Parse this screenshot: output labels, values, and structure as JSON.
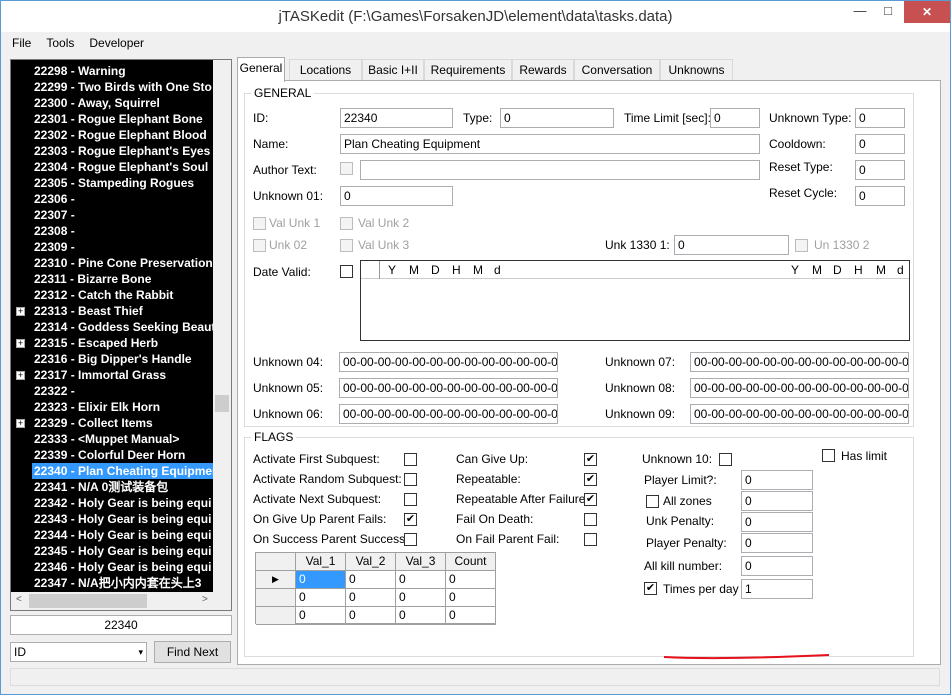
{
  "window": {
    "title": "jTASKedit (F:\\Games\\ForsakenJD\\element\\data\\tasks.data)",
    "close_glyph": "✕",
    "min_glyph": "—",
    "max_glyph": "□"
  },
  "menu": [
    "File",
    "Tools",
    "Developer"
  ],
  "tree": {
    "items": [
      {
        "label": "22298 - Warning",
        "exp": false
      },
      {
        "label": "22299 - Two Birds with One Sto",
        "exp": false
      },
      {
        "label": "22300 - Away, Squirrel",
        "exp": false
      },
      {
        "label": "22301 - Rogue Elephant Bone",
        "exp": false
      },
      {
        "label": "22302 - Rogue Elephant Blood",
        "exp": false
      },
      {
        "label": "22303 - Rogue Elephant's Eyes",
        "exp": false
      },
      {
        "label": "22304 - Rogue Elephant's Soul",
        "exp": false
      },
      {
        "label": "22305 - Stampeding Rogues",
        "exp": false
      },
      {
        "label": "22306 -",
        "exp": false
      },
      {
        "label": "22307 -",
        "exp": false
      },
      {
        "label": "22308 -",
        "exp": false
      },
      {
        "label": "22309 -",
        "exp": false
      },
      {
        "label": "22310 - Pine Cone Preservation",
        "exp": false
      },
      {
        "label": "22311 - Bizarre Bone",
        "exp": false
      },
      {
        "label": "22312 - Catch the Rabbit",
        "exp": false
      },
      {
        "label": "22313 - Beast Thief",
        "exp": true
      },
      {
        "label": "22314 - Goddess Seeking Beaut",
        "exp": false
      },
      {
        "label": "22315 - Escaped Herb",
        "exp": true
      },
      {
        "label": "22316 - Big Dipper's Handle",
        "exp": false
      },
      {
        "label": "22317 - Immortal Grass",
        "exp": true
      },
      {
        "label": "22322 -",
        "exp": false
      },
      {
        "label": "22323 - Elixir Elk Horn",
        "exp": false
      },
      {
        "label": "22329 - Collect Items",
        "exp": true
      },
      {
        "label": "22333 - <Muppet Manual>",
        "exp": false
      },
      {
        "label": "22339 - Colorful Deer Horn",
        "exp": false
      },
      {
        "label": "22340 - Plan Cheating Equipmen",
        "exp": false,
        "selected": true
      },
      {
        "label": "22341 - N/A 0测试装备包",
        "exp": false
      },
      {
        "label": "22342 - Holy Gear is being equi",
        "exp": false
      },
      {
        "label": "22343 - Holy Gear is being equi",
        "exp": false
      },
      {
        "label": "22344 - Holy Gear is being equi",
        "exp": false
      },
      {
        "label": "22345 - Holy Gear is being equi",
        "exp": false
      },
      {
        "label": "22346 - Holy Gear is being equi",
        "exp": false
      },
      {
        "label": "22347 - N/A把小内内套在头上3",
        "exp": false
      }
    ],
    "expand_glyph": "+",
    "scroll_left": "<",
    "scroll_right": ">"
  },
  "search": {
    "value": "22340",
    "field_select": "ID",
    "arrow": "▾",
    "find_next": "Find Next"
  },
  "tabs": [
    "General",
    "Locations",
    "Basic I+II",
    "Requirements",
    "Rewards",
    "Conversation",
    "Unknowns"
  ],
  "general": {
    "title": "GENERAL",
    "id_label": "ID:",
    "id": "22340",
    "type_label": "Type:",
    "type": "0",
    "time_limit_label": "Time Limit [sec]:",
    "time_limit": "0",
    "unknown_type_label": "Unknown Type:",
    "unknown_type": "0",
    "name_label": "Name:",
    "name": "Plan Cheating Equipment",
    "cooldown_label": "Cooldown:",
    "cooldown": "0",
    "author_label": "Author Text:",
    "author": "",
    "reset_type_label": "Reset Type:",
    "reset_type": "0",
    "unknown01_label": "Unknown 01:",
    "unknown01": "0",
    "reset_cycle_label": "Reset Cycle:",
    "reset_cycle": "0",
    "val_unk1": "Val Unk 1",
    "val_unk2": "Val Unk 2",
    "unk02": "Unk 02",
    "val_unk3": "Val Unk 3",
    "unk1330_1_label": "Unk 1330 1:",
    "unk1330_1": "0",
    "unk1330_2": "Un 1330 2",
    "date_valid_label": "Date Valid:",
    "date_cols": [
      "Y",
      "M",
      "D",
      "H",
      "M",
      "d"
    ],
    "unknown04_label": "Unknown 04:",
    "unknown04": "00-00-00-00-00-00-00-00-00-00-00-00-00-00-0",
    "unknown05_label": "Unknown 05:",
    "unknown05": "00-00-00-00-00-00-00-00-00-00-00-00-00-00-0",
    "unknown06_label": "Unknown 06:",
    "unknown06": "00-00-00-00-00-00-00-00-00-00-00-00-00",
    "unknown07_label": "Unknown 07:",
    "unknown07": "00-00-00-00-00-00-00-00-00-00-00-00-00-00-0",
    "unknown08_label": "Unknown 08:",
    "unknown08": "00-00-00-00-00-00-00-00-00-00-00-00-00-00-0",
    "unknown09_label": "Unknown 09:",
    "unknown09": "00-00-00-00-00-00-00-00-00-00-00-00-00-00-0"
  },
  "flags": {
    "title": "FLAGS",
    "col1": [
      {
        "label": "Activate First Subquest:",
        "checked": false
      },
      {
        "label": "Activate Random Subquest:",
        "checked": false
      },
      {
        "label": "Activate Next Subquest:",
        "checked": false
      },
      {
        "label": "On Give Up Parent Fails:",
        "checked": true
      },
      {
        "label": "On Success Parent Success:",
        "checked": false
      }
    ],
    "col2": [
      {
        "label": "Can Give Up:",
        "checked": true
      },
      {
        "label": "Repeatable:",
        "checked": true
      },
      {
        "label": "Repeatable After Failure:",
        "checked": true
      },
      {
        "label": "Fail On Death:",
        "checked": false
      },
      {
        "label": "On Fail Parent Fail:",
        "checked": false
      }
    ],
    "unknown10_label": "Unknown 10:",
    "has_limit_label": "Has limit",
    "player_limit_label": "Player Limit?:",
    "player_limit": "0",
    "all_zones_label": "All zones",
    "all_zones": "0",
    "unk_penalty_label": "Unk Penalty:",
    "unk_penalty": "0",
    "player_penalty_label": "Player Penalty:",
    "player_penalty": "0",
    "all_kill_label": "All kill number:",
    "all_kill": "0",
    "times_per_day_label": "Times per day",
    "times_per_day": "1",
    "check_glyph": "✔"
  },
  "grid": {
    "headers": [
      "Val_1",
      "Val_2",
      "Val_3",
      "Count"
    ],
    "rows": [
      [
        "0",
        "0",
        "0",
        "0"
      ],
      [
        "0",
        "0",
        "0",
        "0"
      ],
      [
        "0",
        "0",
        "0",
        "0"
      ]
    ],
    "row_marker": "▶"
  },
  "colors": {
    "selection": "#3399ff",
    "annotation": "#e8101a",
    "close": "#c75050"
  }
}
